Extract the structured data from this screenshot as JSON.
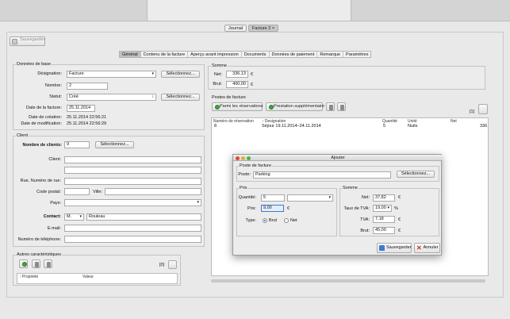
{
  "doc_tabs": [
    {
      "label": "Journal"
    },
    {
      "label": "Facture 2",
      "close": "×"
    }
  ],
  "toolbar": {
    "save_label": "Sauvegarder"
  },
  "section_tabs": [
    "Général",
    "Contenu de la facture",
    "Aperçu avant impression",
    "Documents",
    "Données de paiement",
    "Remarque",
    "Paramètres"
  ],
  "base": {
    "title": "Données de base",
    "designation_label": "Désignation:",
    "designation_value": "Facture",
    "number_label": "Nombre:",
    "number_value": "2",
    "status_label": "Statut:",
    "status_value": "Créé",
    "select_label": "Sélectionnez...",
    "invoice_date_label": "Date de la facture:",
    "invoice_date_value": "25.11.2014",
    "created_label": "Date de création:",
    "created_value": "25.11.2014 22:56:21",
    "modified_label": "Date de modification:",
    "modified_value": "25.11.2014 22:56:29"
  },
  "client": {
    "title": "Client",
    "num_label": "Nombre de clients:",
    "num_value": "9",
    "select_label": "Sélectionnez...",
    "client_label": "Client:",
    "street_label": "Rue, Numéro de rue:",
    "postal_label": "Code postal:",
    "city_label": "Ville:",
    "country_label": "Pays:",
    "contact_label": "Contact:",
    "salutation": "M.",
    "contact_name": "Rouleau",
    "email_label": "E-mail:",
    "phone_label": "Numéro de téléphone:"
  },
  "other": {
    "title": "Autres caractéristiques",
    "count": "[0]",
    "col_property": "↑ Propriété",
    "col_value": "Valeur"
  },
  "sum": {
    "title": "Somme",
    "net_label": "Net:",
    "net_value": "336,13",
    "brut_label": "Brut:",
    "brut_value": "400,00",
    "currency": "€"
  },
  "positions": {
    "title": "Postes de facture",
    "btn_reservations": "Parmi les réservations",
    "btn_extra": "Prestation supplémentaire",
    "count": "[1]",
    "columns": [
      "Numéro de réservation",
      "↑ Designation",
      "Quantité",
      "Unité",
      "Net"
    ],
    "rows": [
      {
        "num": "8",
        "designation": "Séjour 19.11.2014–24.11.2014",
        "qty": "5",
        "unit": "Nuits",
        "net": "336"
      }
    ]
  },
  "dialog": {
    "title": "Ajouter",
    "post_group": "Poste de facture",
    "post_label": "Poste:",
    "post_value": "Parking",
    "select_label": "Sélectionnez...",
    "price_group": "Prix",
    "qty_label": "Quantité:",
    "qty_value": "5",
    "price_label": "Prix:",
    "price_value": "9,00",
    "currency": "€",
    "type_label": "Type:",
    "type_brut": "Brut",
    "type_net": "Net",
    "sum_group": "Somme",
    "net_label": "Net:",
    "net_value": "37,82",
    "vat_rate_label": "Taux de TVA:",
    "vat_rate_value": "19,00",
    "percent": "%",
    "vat_label": "TVA:",
    "vat_value": "7,18",
    "brut_label": "Brut:",
    "brut_value": "45,00",
    "save_label": "Sauvegarder",
    "cancel_label": "Annuler"
  },
  "colors": {
    "accent": "#3b7bd4",
    "cancel": "#d22b2b",
    "green": "#3fa33f"
  }
}
